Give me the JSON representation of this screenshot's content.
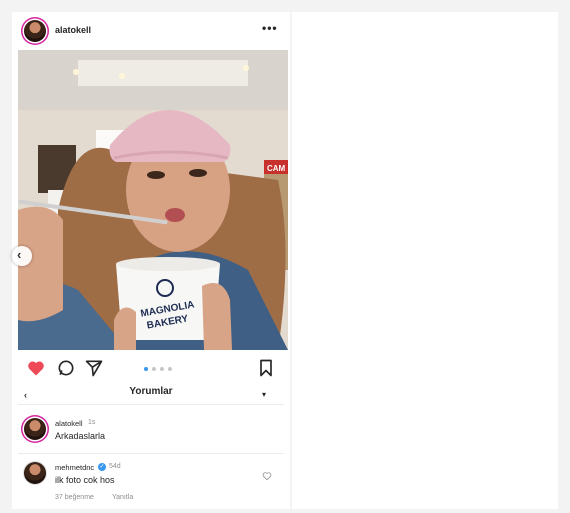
{
  "post": {
    "username": "alatokell",
    "more_icon": "more-horizontal-icon",
    "photo": {
      "cup_brand_line1": "MAGNOLIA",
      "cup_brand_line2": "BAKERY",
      "store_sign": "CAM"
    },
    "carousel": {
      "total": 4,
      "active": 1
    },
    "actions": [
      "heart-icon",
      "comment-icon",
      "share-icon",
      "bookmark-icon"
    ],
    "liked": true,
    "colors": {
      "like": "#ed4956",
      "dot_active": "#3897f0",
      "dot_inactive": "#c7c7c7",
      "verified": "#3897f0"
    }
  },
  "comments_panel": {
    "title": "Yorumlar",
    "items": [
      {
        "username": "alatokell",
        "time": "1s",
        "text": "Arkadaslarla"
      },
      {
        "username": "mehmetdnc",
        "time": "54d",
        "text": "ilk foto cok hos",
        "likes": "37 beğenme",
        "reply": "Yanıtla",
        "verified": true
      }
    ]
  }
}
